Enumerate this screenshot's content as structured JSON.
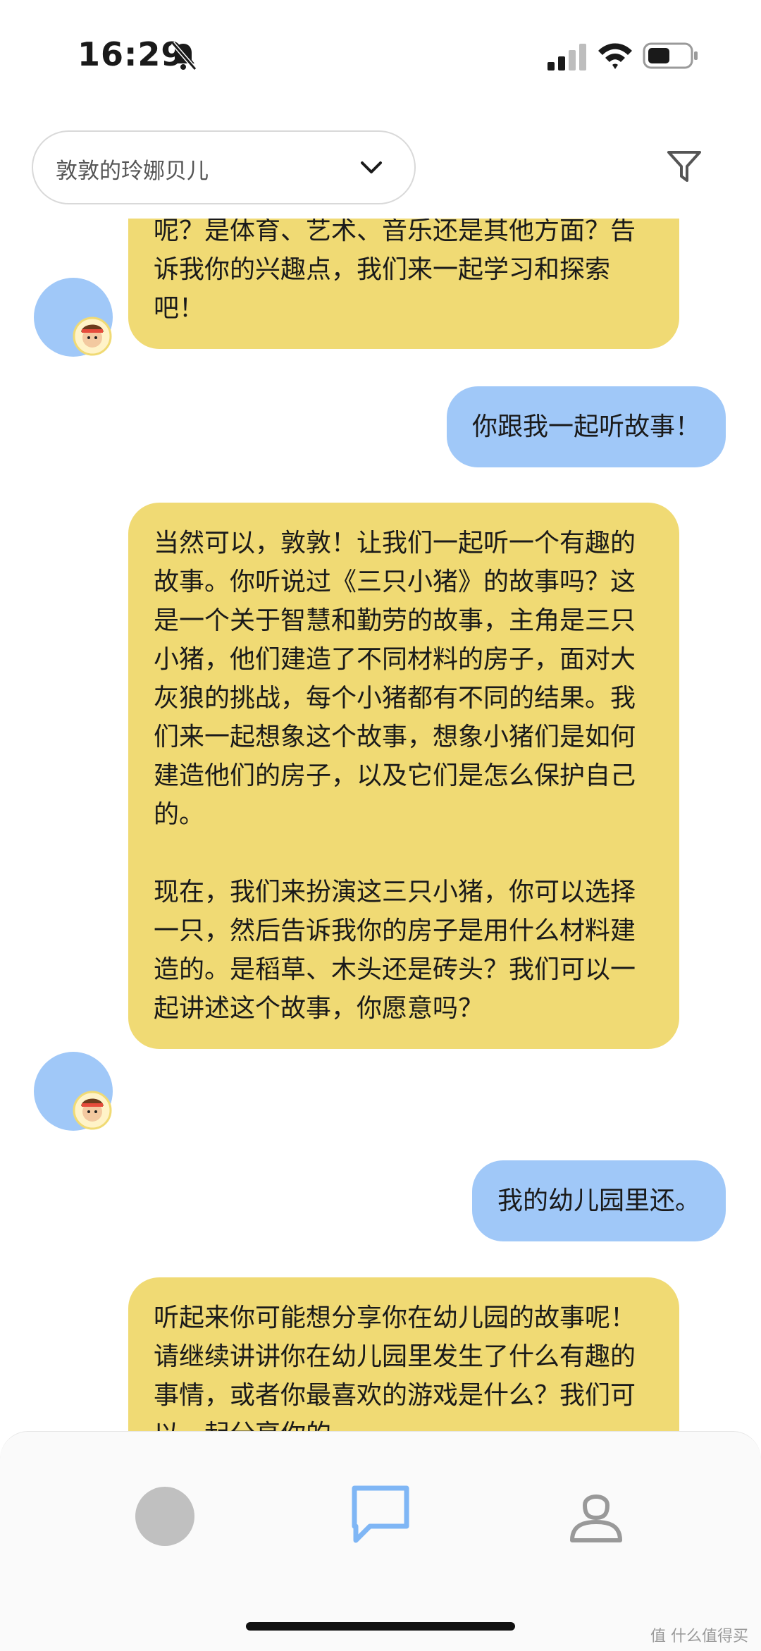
{
  "status_bar": {
    "time": "16:29"
  },
  "header": {
    "profile_name": "敦敦的玲娜贝儿"
  },
  "chat": {
    "messages": [
      {
        "role": "bot",
        "text": "呢？是体育、艺术、音乐还是其他方面？告诉我你的兴趣点，我们来一起学习和探索吧！"
      },
      {
        "role": "user",
        "text": "你跟我一起听故事！"
      },
      {
        "role": "bot",
        "text": "当然可以，敦敦！让我们一起听一个有趣的故事。你听说过《三只小猪》的故事吗？这是一个关于智慧和勤劳的故事，主角是三只小猪，他们建造了不同材料的房子，面对大灰狼的挑战，每个小猪都有不同的结果。我们来一起想象这个故事，想象小猪们是如何建造他们的房子，以及它们是怎么保护自己的。\n\n现在，我们来扮演这三只小猪，你可以选择一只，然后告诉我你的房子是用什么材料建造的。是稻草、木头还是砖头？我们可以一起讲述这个故事，你愿意吗？"
      },
      {
        "role": "user",
        "text": "我的幼儿园里还。"
      },
      {
        "role": "bot",
        "text": "听起来你可能想分享你在幼儿园的故事呢！请继续讲讲你在幼儿园里发生了什么有趣的事情，或者你最喜欢的游戏是什么？我们可以一起分享你的"
      }
    ]
  },
  "colors": {
    "bot_bubble": "#f0da74",
    "user_bubble": "#a0c8f8",
    "accent": "#7fb6f5"
  },
  "icons": [
    "bell-slash-icon",
    "signal-icon",
    "wifi-icon",
    "battery-icon",
    "chevron-down-icon",
    "filter-icon",
    "chat-icon",
    "user-icon"
  ],
  "watermark": "值 什么值得买"
}
